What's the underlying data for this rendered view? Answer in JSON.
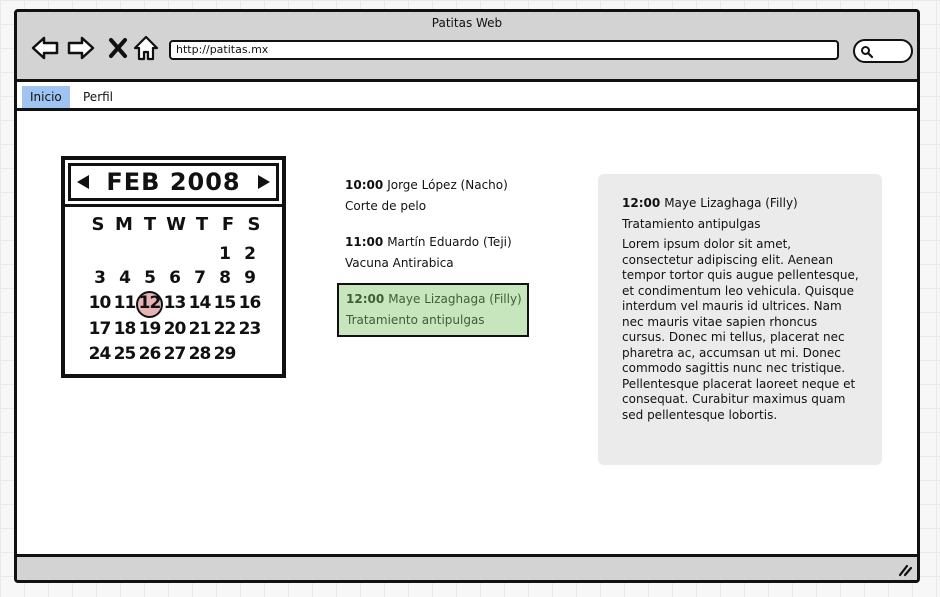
{
  "window": {
    "title": "Patitas Web"
  },
  "toolbar": {
    "url": "http://patitas.mx",
    "icons": [
      "back-arrow-icon",
      "forward-arrow-icon",
      "close-x-icon",
      "home-icon",
      "search-icon"
    ]
  },
  "tabs": [
    {
      "label": "Inicio",
      "active": true
    },
    {
      "label": "Perfil",
      "active": false
    }
  ],
  "calendar": {
    "month_label": "FEB 2008",
    "weekday_headers": [
      "S",
      "M",
      "T",
      "W",
      "T",
      "F",
      "S"
    ],
    "weeks": [
      [
        "",
        "",
        "",
        "",
        "",
        "1",
        "2"
      ],
      [
        "3",
        "4",
        "5",
        "6",
        "7",
        "8",
        "9"
      ],
      [
        "10",
        "11",
        "12",
        "13",
        "14",
        "15",
        "16"
      ],
      [
        "17",
        "18",
        "19",
        "20",
        "21",
        "22",
        "23"
      ],
      [
        "24",
        "25",
        "26",
        "27",
        "28",
        "29",
        ""
      ]
    ],
    "selected_day": "12",
    "selected_color": "#e7b3b3"
  },
  "appointments": [
    {
      "time": "10:00",
      "name": "Jorge López (Nacho)",
      "service": "Corte de pelo"
    },
    {
      "time": "11:00",
      "name": "Martín Eduardo (Teji)",
      "service": "Vacuna Antirabica"
    },
    {
      "time": "12:00",
      "name": "Maye Lizaghaga (Filly)",
      "service": "Tratamiento antipulgas",
      "selected": true
    }
  ],
  "detail": {
    "time": "12:00",
    "name": "Maye Lizaghaga (Filly)",
    "service": "Tratamiento antipulgas",
    "body": "Lorem ipsum dolor sit amet, consectetur adipiscing elit. Aenean tempor tortor quis augue pellentesque, et condimentum leo vehicula. Quisque interdum vel mauris id ultrices. Nam nec mauris vitae sapien rhoncus cursus. Donec mi tellus, placerat nec pharetra ac, accumsan ut mi. Donec commodo sagittis nunc nec tristique. Pellentesque placerat laoreet neque et consequat. Curabitur maximus quam sed pellentesque lobortis."
  },
  "colors": {
    "chrome": "#d3d3d3",
    "active_tab": "#9fc4f2",
    "selected_appointment": "#c7e6bd",
    "detail_panel": "#ebebeb"
  }
}
